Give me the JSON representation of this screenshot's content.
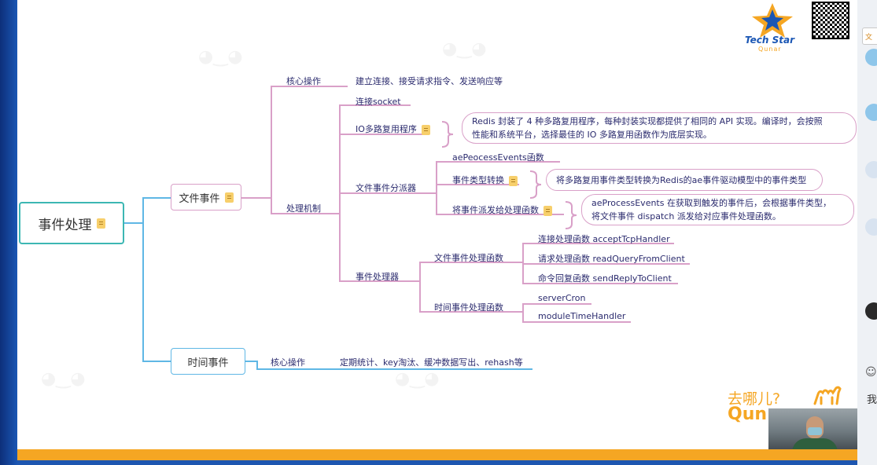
{
  "colors": {
    "root": "#3cb7b3",
    "file_branch": "#d9a0c8",
    "time_branch": "#5fb7e5",
    "accent": "#f5a623",
    "frame": "#1d56b0"
  },
  "branding": {
    "logo_title": "Tech Star",
    "logo_sub": "Qunar",
    "bottom_text": "去哪儿?",
    "bottom_logo": "Qun"
  },
  "mindmap": {
    "root": "事件处理",
    "file_event": {
      "label": "文件事件",
      "core_op": {
        "label": "核心操作",
        "detail": "建立连接、接受请求指令、发送响应等"
      },
      "mechanism": {
        "label": "处理机制",
        "socket": "连接socket",
        "io_mux": {
          "label": "IO多路复用程序",
          "note_line1": "Redis 封装了 4 种多路复用程序，每种封装实现都提供了相同的 API 实现。编译时，会按照",
          "note_line2": "性能和系统平台，选择最佳的 IO 多路复用函数作为底层实现。"
        },
        "dispatcher": {
          "label": "文件事件分派器",
          "ae_process": "aePeocessEvents函数",
          "type_convert": {
            "label": "事件类型转换",
            "note": "将多路复用事件类型转换为Redis的ae事件驱动模型中的事件类型"
          },
          "dispatch": {
            "label": "将事件派发给处理函数",
            "note_line1": "aeProcessEvents 在获取到触发的事件后，会根据事件类型，",
            "note_line2": "将文件事件 dispatch 派发给对应事件处理函数。"
          }
        },
        "handler": {
          "label": "事件处理器",
          "file_handler": {
            "label": "文件事件处理函数",
            "items": [
              "连接处理函数 acceptTcpHandler",
              "请求处理函数 readQueryFromClient",
              "命令回复函数 sendReplyToClient"
            ]
          },
          "time_handler": {
            "label": "时间事件处理函数",
            "items": [
              "serverCron",
              "moduleTimeHandler"
            ]
          }
        }
      }
    },
    "time_event": {
      "label": "时间事件",
      "core_op": {
        "label": "核心操作",
        "detail": "定期统计、key淘汰、缓冲数据写出、rehash等"
      }
    }
  },
  "side_panel": {
    "button_text": "文",
    "chat_text": "我"
  }
}
